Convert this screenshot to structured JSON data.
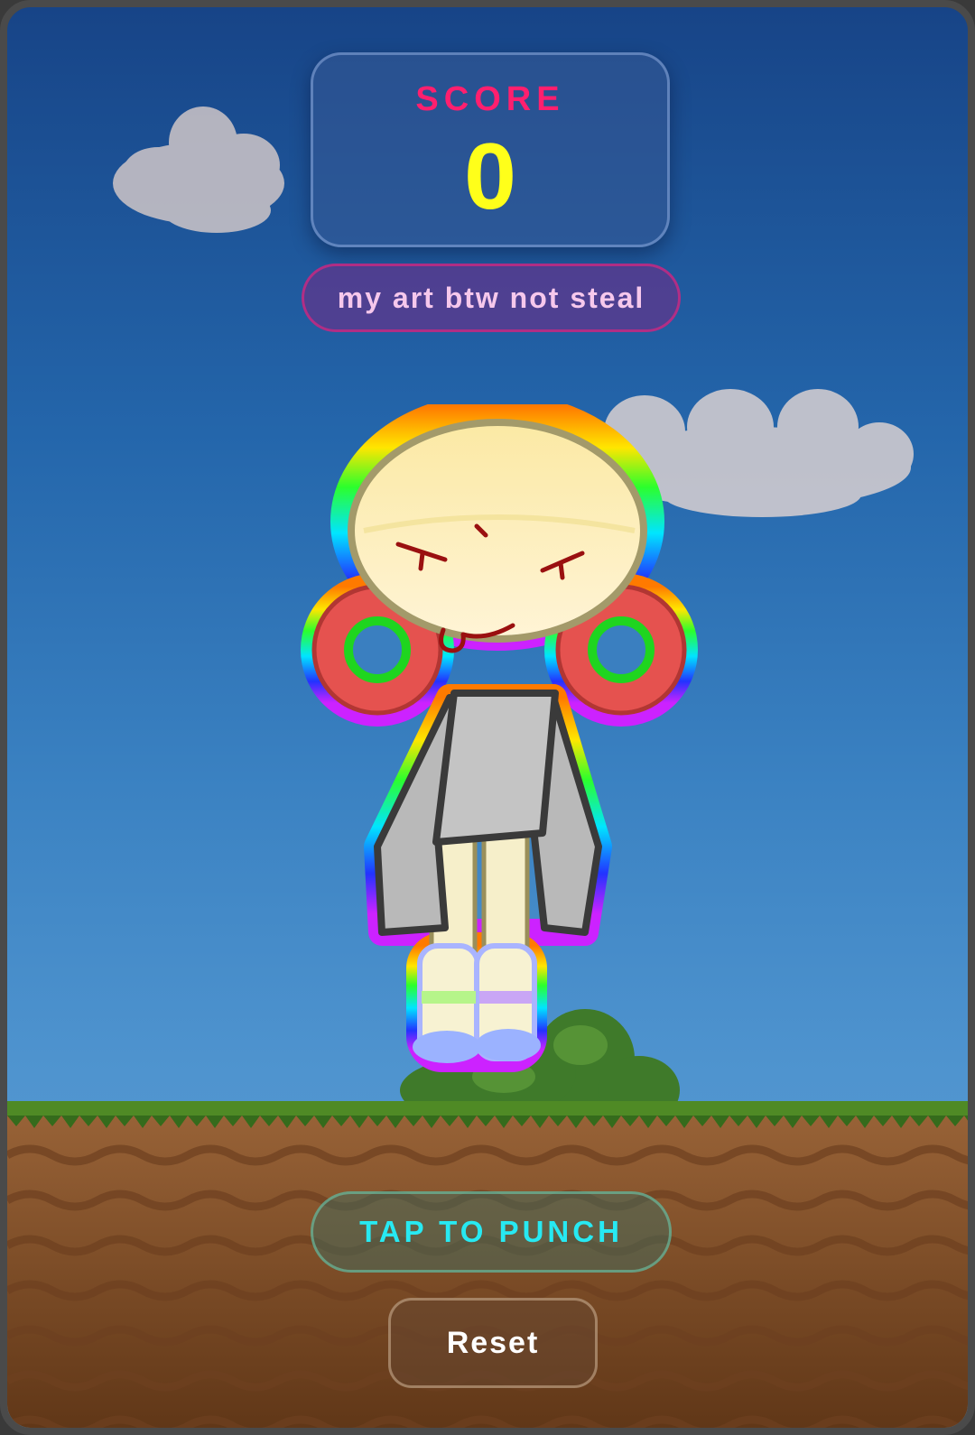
{
  "score": {
    "label": "SCORE",
    "value": "0"
  },
  "caption": "my art btw not steal",
  "buttons": {
    "punch_label": "TAP TO PUNCH",
    "reset_label": "Reset"
  },
  "colors": {
    "score_label": "#ff1f6e",
    "score_value": "#ffff1a",
    "punch_text": "#27e9f2",
    "caption_text": "#f6c8ec"
  },
  "icons": [
    "cloud-icon",
    "bush-icon",
    "character-sprite"
  ]
}
